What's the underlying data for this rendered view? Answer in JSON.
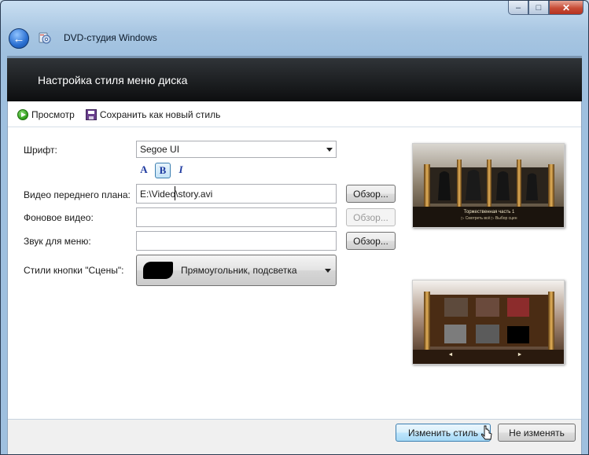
{
  "window": {
    "title": "DVD-студия Windows",
    "caption": {
      "minimize": "‒",
      "maximize": "□",
      "close": "✕"
    }
  },
  "header": {
    "title": "Настройка стиля меню диска"
  },
  "toolbar": {
    "preview_label": "Просмотр",
    "save_style_label": "Сохранить как новый стиль"
  },
  "form": {
    "font_label": "Шрифт:",
    "font_value": "Segoe UI",
    "format_buttons": {
      "color": "A",
      "bold": "B",
      "italic": "I"
    },
    "foreground_label": "Видео переднего плана:",
    "foreground_value": "E:\\Video\\story.avi",
    "background_label": "Фоновое видео:",
    "background_value": "",
    "audio_label": "Звук для меню:",
    "audio_value": "",
    "browse_label": "Обзор...",
    "scene_buttons_label": "Стили кнопки \"Сцены\":",
    "scene_buttons_value": "Прямоугольник, подсветка"
  },
  "preview": {
    "top_caption": "Торжественная часть 1",
    "top_subcaption": "▷ Смотреть всё  ▷ Выбор сцен",
    "page_left": "◄",
    "page_right": "►"
  },
  "footer": {
    "apply_label": "Изменить стиль",
    "cancel_label": "Не изменять"
  },
  "colors": {
    "header_bg": "#0b0c0d",
    "accent": "#3c7fb1"
  }
}
